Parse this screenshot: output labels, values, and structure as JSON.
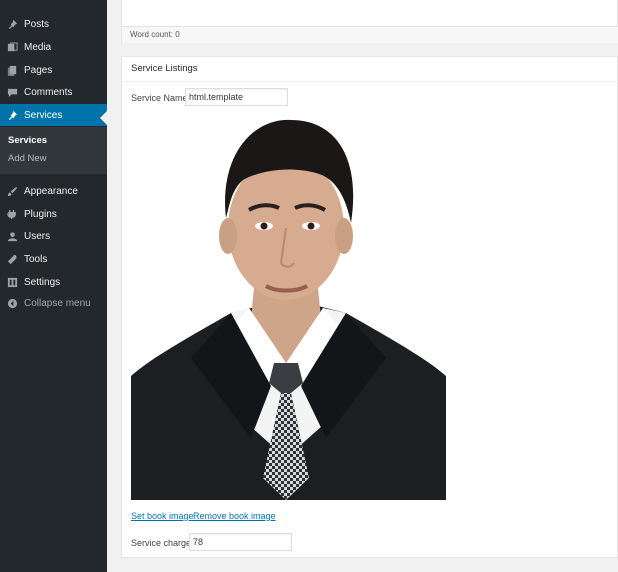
{
  "sidebar": {
    "items": [
      {
        "label": "Posts",
        "icon": "pin-icon"
      },
      {
        "label": "Media",
        "icon": "media-icon"
      },
      {
        "label": "Pages",
        "icon": "pages-icon"
      },
      {
        "label": "Comments",
        "icon": "comments-icon"
      },
      {
        "label": "Services",
        "icon": "pin-icon",
        "active": true
      },
      {
        "label": "Appearance",
        "icon": "brush-icon"
      },
      {
        "label": "Plugins",
        "icon": "plug-icon"
      },
      {
        "label": "Users",
        "icon": "user-icon"
      },
      {
        "label": "Tools",
        "icon": "wrench-icon"
      },
      {
        "label": "Settings",
        "icon": "settings-icon"
      }
    ],
    "submenu": [
      {
        "label": "Services",
        "current": true
      },
      {
        "label": "Add New"
      }
    ],
    "collapse_label": "Collapse menu",
    "active_color": "#0073aa",
    "background_color": "#23282d"
  },
  "editor": {
    "word_count": "Word count: 0"
  },
  "listing": {
    "title": "Service Listings",
    "service_name_label": "Service Name",
    "service_name_value": "html.template",
    "set_image_link": "Set book image",
    "remove_image_link": "Remove book image",
    "service_charge_label": "Service charge",
    "service_charge_value": "78"
  }
}
